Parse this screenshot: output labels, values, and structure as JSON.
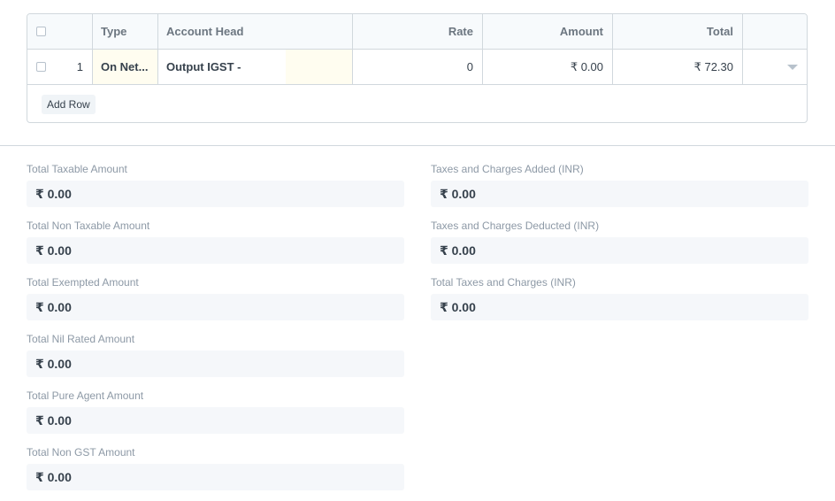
{
  "grid": {
    "headers": {
      "type": "Type",
      "account_head": "Account Head",
      "rate": "Rate",
      "amount": "Amount",
      "total": "Total"
    },
    "rows": [
      {
        "idx": "1",
        "type": "On Net...",
        "account_head": "Output IGST -",
        "rate": "0",
        "amount": "₹ 0.00",
        "total": "₹ 72.30"
      }
    ],
    "add_row_label": "Add Row",
    "highlight_color": "#fffdf0"
  },
  "totals_left": [
    {
      "label": "Total Taxable Amount",
      "value": "₹ 0.00"
    },
    {
      "label": "Total Non Taxable Amount",
      "value": "₹ 0.00"
    },
    {
      "label": "Total Exempted Amount",
      "value": "₹ 0.00"
    },
    {
      "label": "Total Nil Rated Amount",
      "value": "₹ 0.00"
    },
    {
      "label": "Total Pure Agent Amount",
      "value": "₹ 0.00"
    },
    {
      "label": "Total Non GST Amount",
      "value": "₹ 0.00"
    }
  ],
  "totals_right": [
    {
      "label": "Taxes and Charges Added (INR)",
      "value": "₹ 0.00"
    },
    {
      "label": "Taxes and Charges Deducted (INR)",
      "value": "₹ 0.00"
    },
    {
      "label": "Total Taxes and Charges (INR)",
      "value": "₹ 0.00"
    }
  ]
}
